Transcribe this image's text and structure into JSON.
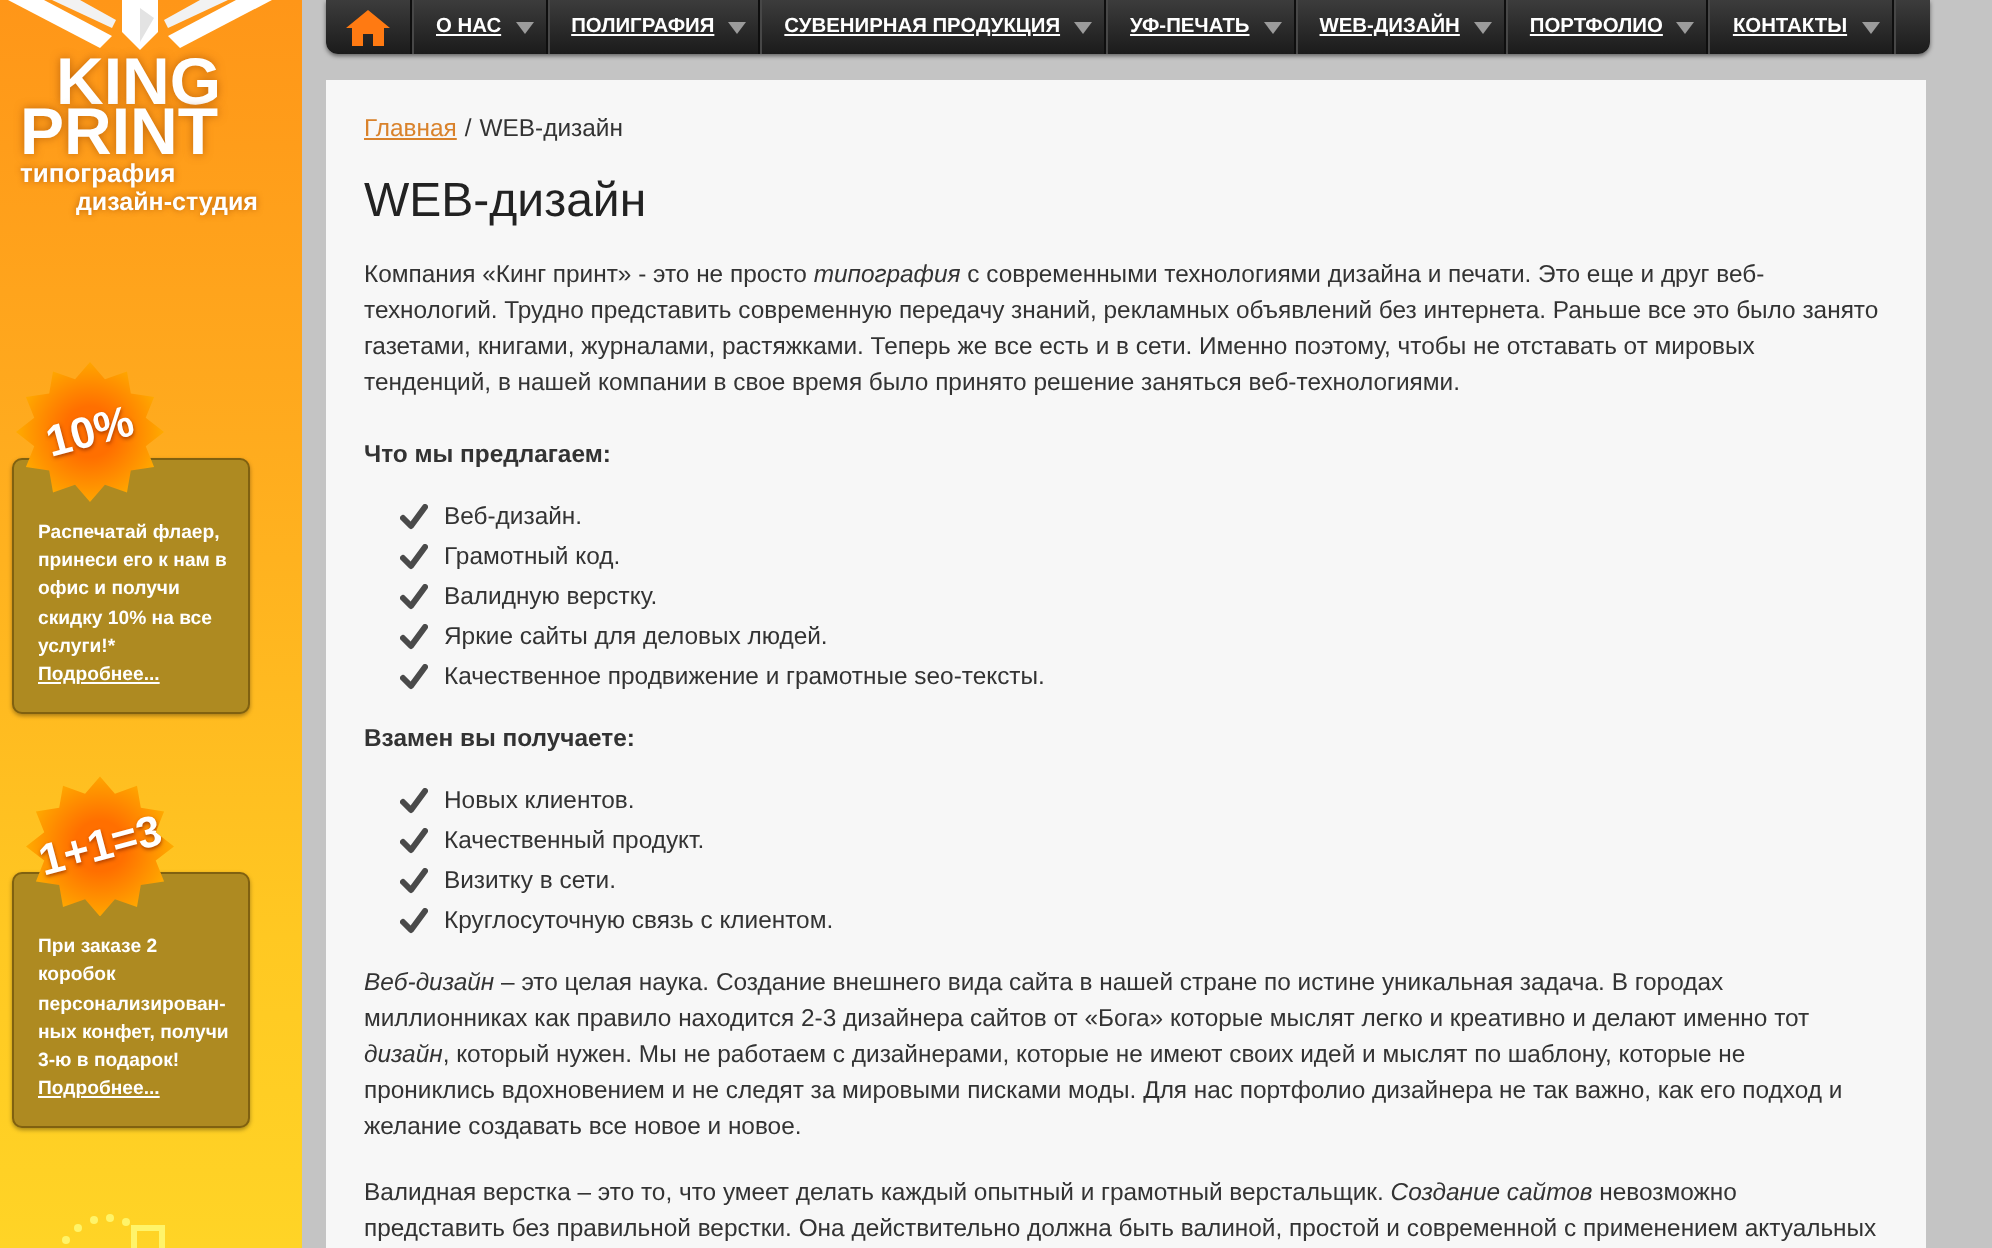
{
  "logo": {
    "word_1": "KING",
    "word_2": "PRINT",
    "tagline_1": "типография",
    "tagline_2": "дизайн-студия"
  },
  "promos": [
    {
      "badge": "10%",
      "text": "Распечатай флаер, принеси его к нам в офис и получи скидку 10% на все услуги!*",
      "link": "Подробнее..."
    },
    {
      "badge": "1+1=3",
      "text": "При заказе 2 коробок персонализирован-ных конфет, получи 3-ю в подарок!",
      "link": "Подробнее..."
    }
  ],
  "nav": {
    "items": [
      {
        "label": "О НАС"
      },
      {
        "label": "ПОЛИГРАФИЯ"
      },
      {
        "label": "СУВЕНИРНАЯ ПРОДУКЦИЯ"
      },
      {
        "label": "УФ-ПЕЧАТЬ"
      },
      {
        "label": "WEB-ДИЗАЙН"
      },
      {
        "label": "ПОРТФОЛИО"
      },
      {
        "label": "КОНТАКТЫ"
      }
    ]
  },
  "breadcrumb": {
    "link": "Главная",
    "separator": "/",
    "current": "WEB-дизайн"
  },
  "title": "WEB-дизайн",
  "intro": "Компания «Кинг принт» - это не просто *типография* с современными технологиями дизайна и печати. Это еще и друг веб-технологий. Трудно представить современную передачу знаний, рекламных объявлений без интернета. Раньше все это было занято газетами, книгами, журналами, растяжками. Теперь же все есть и в сети. Именно поэтому, чтобы не отставать от мировых тенденций, в нашей компании в свое время было принято решение заняться веб-технологиями.",
  "sections": [
    {
      "heading": "Что мы предлагаем:",
      "items": [
        "Веб-дизайн.",
        "Грамотный код.",
        "Валидную верстку.",
        "Яркие сайты для деловых людей.",
        "Качественное продвижение и грамотные seo-тексты."
      ]
    },
    {
      "heading": "Взамен вы получаете:",
      "items": [
        "Новых клиентов.",
        "Качественный продукт.",
        "Визитку в сети.",
        "Круглосуточную связь с клиентом."
      ]
    }
  ],
  "paragraphs": [
    "*Веб-дизайн* – это целая наука. Создание внешнего вида сайта в нашей стране по истине уникальная задача. В городах миллионниках как правило находится 2-3 дизайнера сайтов от «Бога» которые мыслят легко и креативно и делают именно тот *дизайн*, который нужен. Мы не работаем с дизайнерами, которые не имеют своих идей и мыслят по шаблону, которые не прониклись вдохновением и не следят за мировыми писками моды. Для нас портфолио дизайнера не так важно, как его подход и желание создавать все новое и новое.",
    "Валидная верстка – это то, что умеет делать каждый опытный и грамотный верстальщик. *Создание сайтов* невозможно представить без правильной верстки. Она действительно должна быть валиной, простой и современной с применением актуальных"
  ]
}
